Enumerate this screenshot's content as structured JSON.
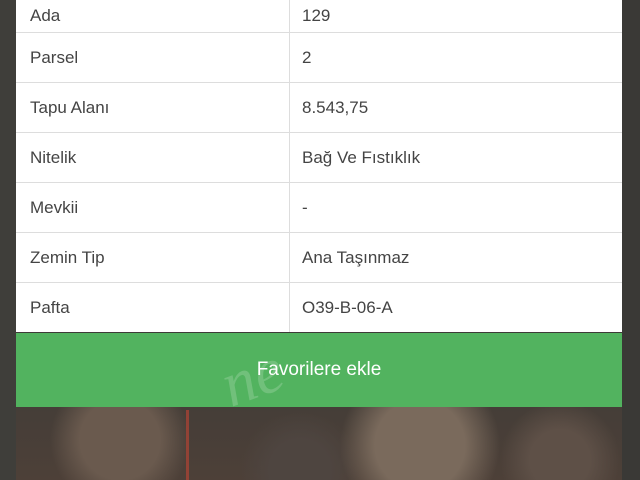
{
  "details": {
    "rows": [
      {
        "label": "Ada",
        "value": "129"
      },
      {
        "label": "Parsel",
        "value": "2"
      },
      {
        "label": "Tapu Alanı",
        "value": "8.543,75"
      },
      {
        "label": "Nitelik",
        "value": "Bağ Ve Fıstıklık"
      },
      {
        "label": "Mevkii",
        "value": "-"
      },
      {
        "label": "Zemin Tip",
        "value": "Ana Taşınmaz"
      },
      {
        "label": "Pafta",
        "value": "O39-B-06-A"
      }
    ]
  },
  "actions": {
    "favorite_label": "Favorilere ekle",
    "favorite_color": "#52b35f"
  },
  "watermark": {
    "text": "ne"
  }
}
